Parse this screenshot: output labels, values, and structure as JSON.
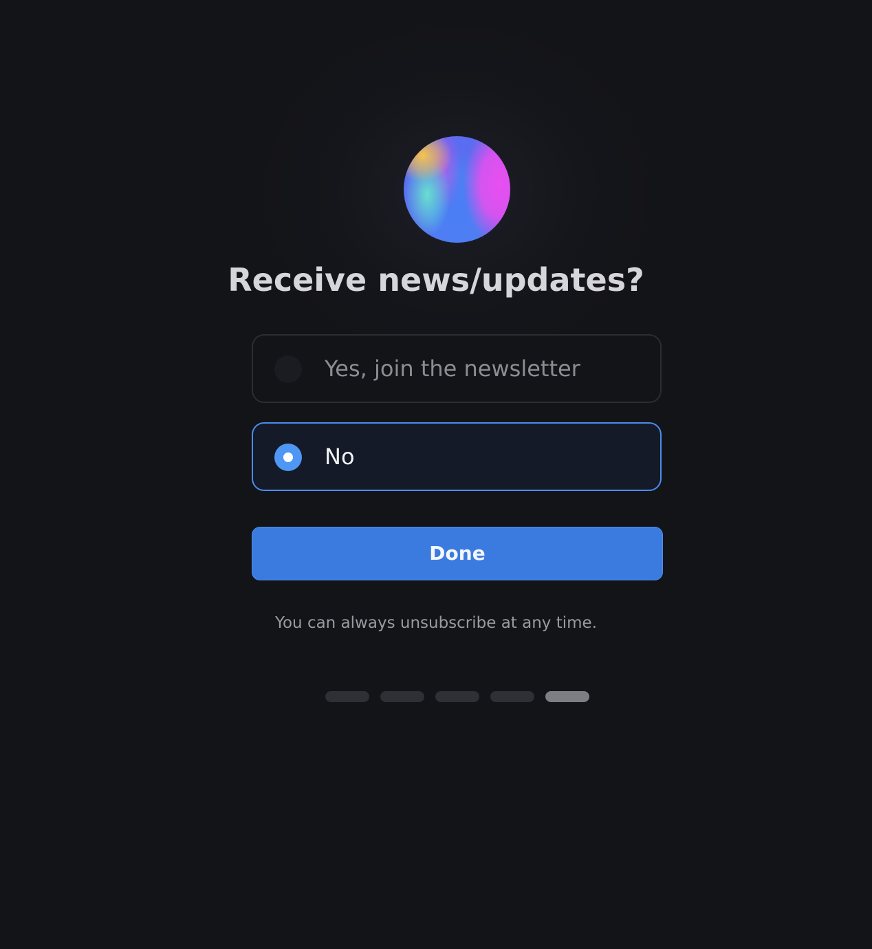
{
  "dialog": {
    "title": "Receive news/updates?",
    "options": [
      {
        "label": "Yes, join the newsletter",
        "selected": false
      },
      {
        "label": "No",
        "selected": true
      }
    ],
    "done_label": "Done",
    "footnote": "You can always unsubscribe at any time."
  },
  "progress": {
    "total_steps": 5,
    "current_step": 5
  },
  "colors": {
    "background": "#131418",
    "accent": "#3b7be0",
    "selected_border": "#4a8df0",
    "radio_selected": "#4f97f5"
  }
}
